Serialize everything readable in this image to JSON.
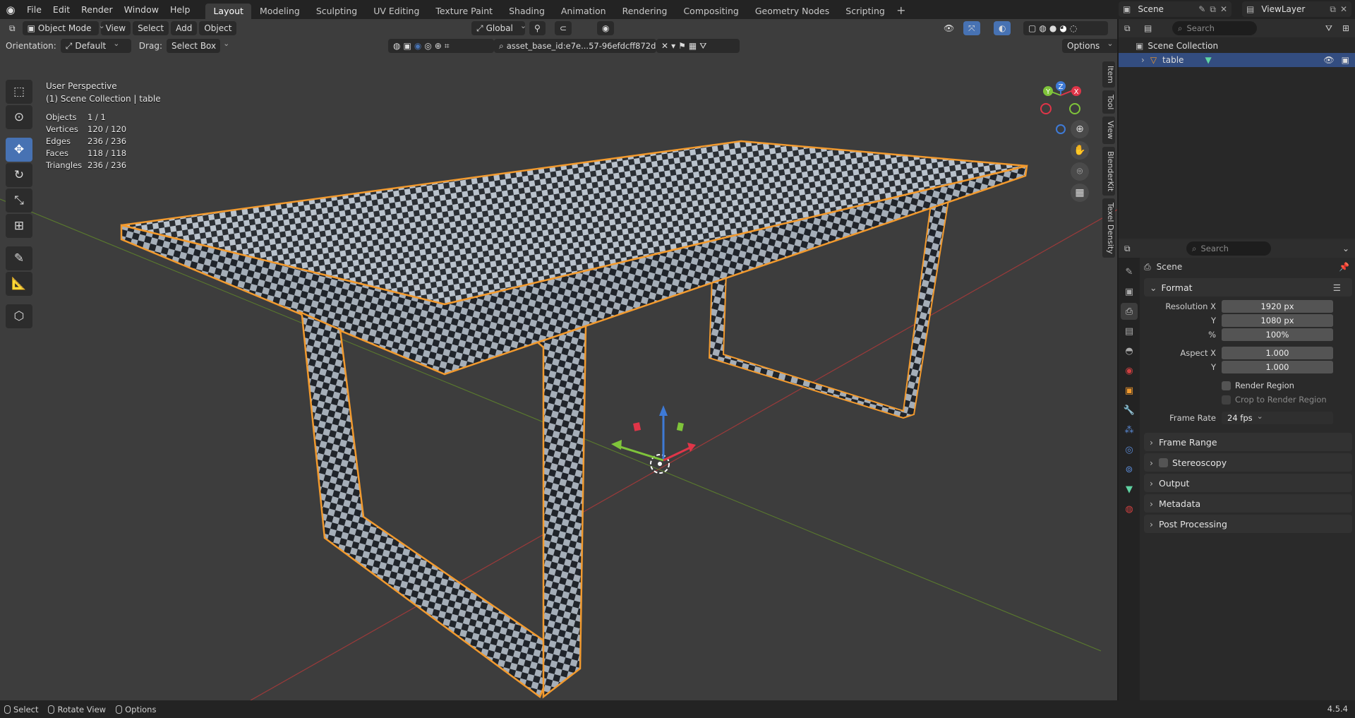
{
  "topbar": {
    "menu": [
      "File",
      "Edit",
      "Render",
      "Window",
      "Help"
    ],
    "workspaces": [
      "Layout",
      "Modeling",
      "Sculpting",
      "UV Editing",
      "Texture Paint",
      "Shading",
      "Animation",
      "Rendering",
      "Compositing",
      "Geometry Nodes",
      "Scripting"
    ],
    "active_workspace": "Layout",
    "scene_name": "Scene",
    "view_layer": "ViewLayer"
  },
  "viewport": {
    "mode": "Object Mode",
    "header_menu": [
      "View",
      "Select",
      "Add",
      "Object"
    ],
    "transform_orientation": "Global",
    "orientation_label": "Orientation:",
    "orientation_value": "Default",
    "drag_label": "Drag:",
    "drag_value": "Select Box",
    "asset_filter": "asset_base_id:e7e...57-96efdcff872d",
    "options_label": "Options",
    "view_name": "User Perspective",
    "collection_info": "(1) Scene Collection | table",
    "stats": [
      {
        "label": "Objects",
        "value": "1 / 1"
      },
      {
        "label": "Vertices",
        "value": "120 / 120"
      },
      {
        "label": "Edges",
        "value": "236 / 236"
      },
      {
        "label": "Faces",
        "value": "118 / 118"
      },
      {
        "label": "Triangles",
        "value": "236 / 236"
      }
    ],
    "side_tabs": [
      "Item",
      "Tool",
      "View",
      "BlenderKit",
      "Texel Density"
    ],
    "gizmo_axes": [
      "X",
      "Y",
      "Z"
    ]
  },
  "outliner": {
    "search_placeholder": "Search",
    "root": "Scene Collection",
    "object": "table"
  },
  "properties": {
    "search_placeholder": "Search",
    "context": "Scene",
    "format_panel": "Format",
    "resolution_x_label": "Resolution X",
    "resolution_x": "1920 px",
    "resolution_y_label": "Y",
    "resolution_y": "1080 px",
    "percent_label": "%",
    "percent": "100%",
    "aspect_x_label": "Aspect X",
    "aspect_x": "1.000",
    "aspect_y_label": "Y",
    "aspect_y": "1.000",
    "render_region": "Render Region",
    "crop_region": "Crop to Render Region",
    "frame_rate_label": "Frame Rate",
    "frame_rate": "24 fps",
    "collapsed_panels": [
      "Frame Range",
      "Stereoscopy",
      "Output",
      "Metadata",
      "Post Processing"
    ]
  },
  "statusbar": {
    "items": [
      "Select",
      "Rotate View",
      "Options"
    ],
    "version": "4.5.4"
  }
}
